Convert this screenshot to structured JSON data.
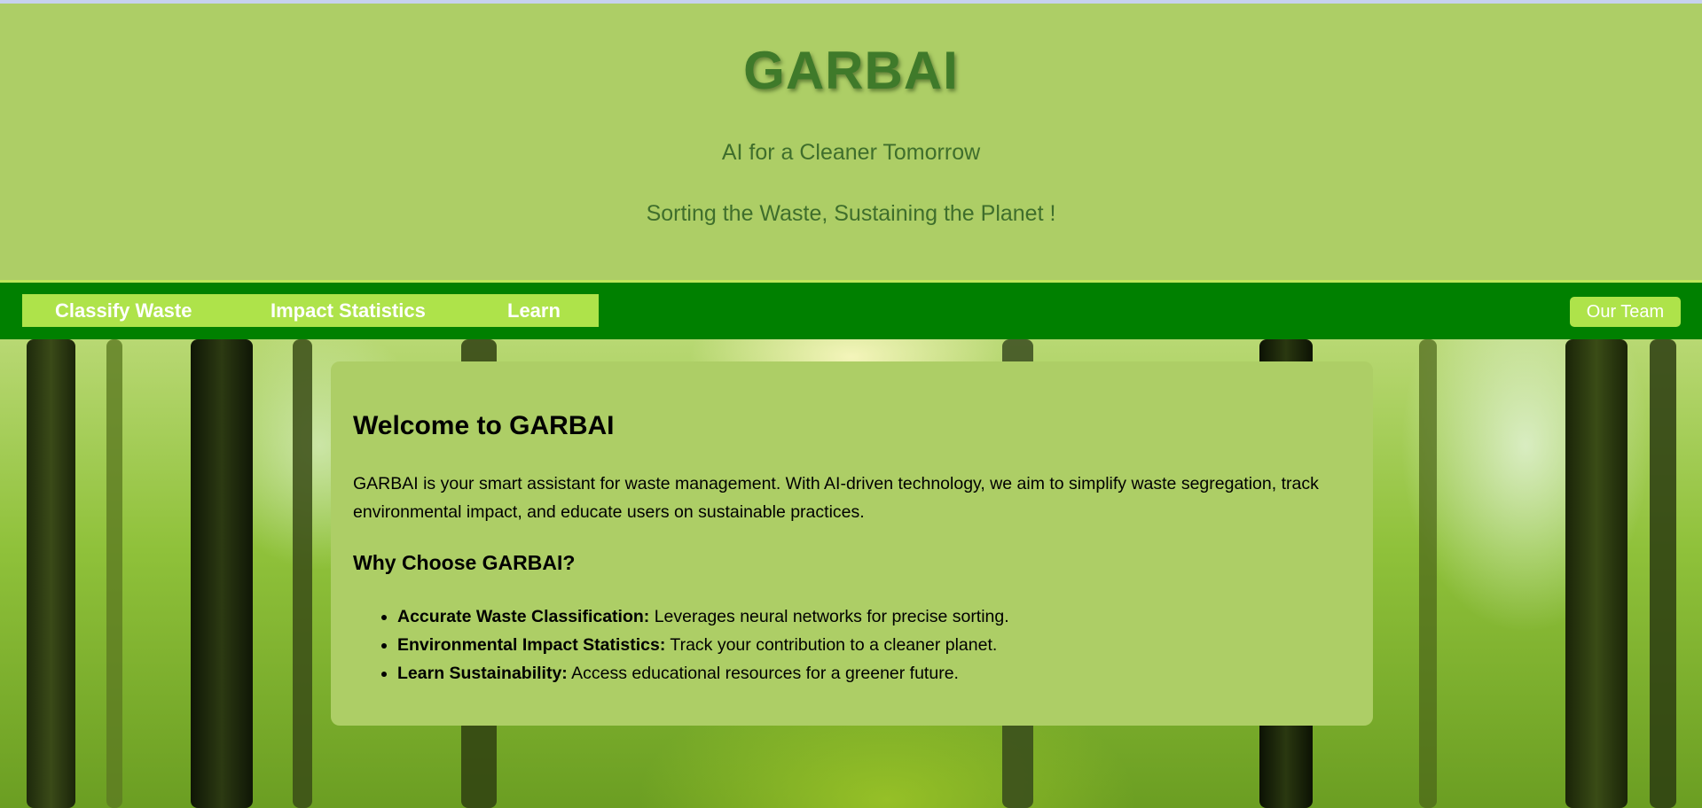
{
  "header": {
    "brand": "GARBAI",
    "tagline_1": "AI for a Cleaner Tomorrow",
    "tagline_2": "Sorting the Waste, Sustaining the Planet !"
  },
  "nav": {
    "links": [
      {
        "label": "Classify Waste"
      },
      {
        "label": "Impact Statistics"
      },
      {
        "label": "Learn"
      }
    ],
    "team_button": "Our Team"
  },
  "main": {
    "title": "Welcome to GARBAI",
    "intro": "GARBAI is your smart assistant for waste management. With AI-driven technology, we aim to simplify waste segregation, track environmental impact, and educate users on sustainable practices.",
    "why_heading": "Why Choose GARBAI?",
    "features": [
      {
        "title": "Accurate Waste Classification:",
        "text": " Leverages neural networks for precise sorting."
      },
      {
        "title": "Environmental Impact Statistics:",
        "text": " Track your contribution to a cleaner planet."
      },
      {
        "title": "Learn Sustainability:",
        "text": " Access educational resources for a greener future."
      }
    ]
  },
  "colors": {
    "header_bg": "#adce66",
    "nav_bg": "#008000",
    "nav_accent": "#aee34a",
    "brand_text": "#3f7a2a",
    "card_bg": "#adce66"
  },
  "background": {
    "image": "forest-background"
  }
}
